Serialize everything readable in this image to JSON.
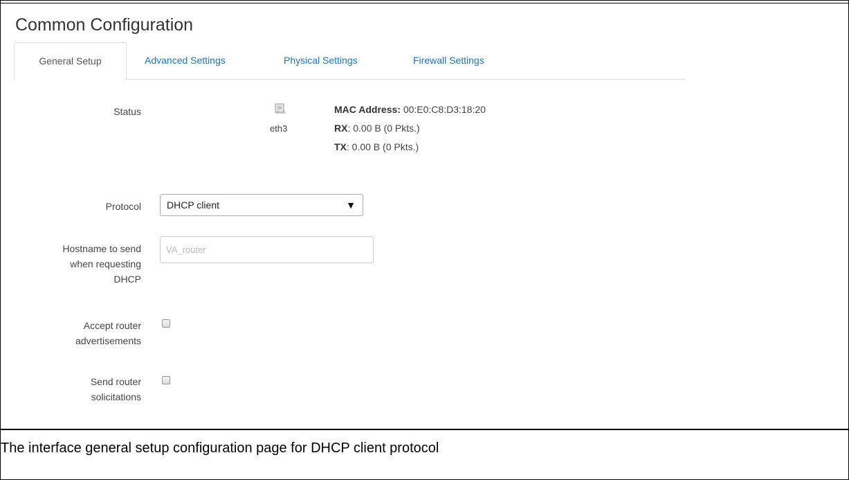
{
  "panel": {
    "title": "Common Configuration",
    "tabs": [
      {
        "label": "General Setup",
        "active": true
      },
      {
        "label": "Advanced Settings",
        "active": false
      },
      {
        "label": "Physical Settings",
        "active": false
      },
      {
        "label": "Firewall Settings",
        "active": false
      }
    ]
  },
  "status": {
    "label": "Status",
    "icon": "ethernet-port-icon",
    "device": "eth3",
    "mac_label": "MAC Address:",
    "mac_value": " 00:E0:C8:D3:18:20",
    "rx_label": "RX",
    "rx_value": ": 0.00 B (0 Pkts.)",
    "tx_label": "TX",
    "tx_value": ": 0.00 B (0 Pkts.)"
  },
  "protocol": {
    "label": "Protocol",
    "selected": "DHCP client",
    "arrow": "▼"
  },
  "hostname": {
    "label_lines": [
      "Hostname to send",
      "when requesting",
      "DHCP"
    ],
    "placeholder": "VA_router",
    "value": ""
  },
  "accept_ra": {
    "label_lines": [
      "Accept router",
      "advertisements"
    ],
    "checked": false
  },
  "send_rs": {
    "label_lines": [
      "Send router",
      "solicitations"
    ],
    "checked": false
  },
  "caption": "The interface general setup configuration page for DHCP client protocol",
  "colors": {
    "link": "#1a75c8",
    "border": "#dddddd"
  }
}
